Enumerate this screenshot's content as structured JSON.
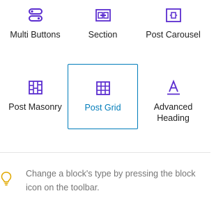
{
  "blocks": [
    {
      "label": "Multi Buttons",
      "icon": "toggle-buttons-icon"
    },
    {
      "label": "Section",
      "icon": "section-icon"
    },
    {
      "label": "Post Carousel",
      "icon": "carousel-icon"
    },
    {
      "label": "Post Masonry",
      "icon": "masonry-icon"
    },
    {
      "label": "Post Grid",
      "icon": "grid-icon",
      "selected": true
    },
    {
      "label": "Advanced Heading",
      "icon": "heading-icon"
    }
  ],
  "tip": {
    "icon": "lightbulb-icon",
    "text": "Change a block's type by pressing the block icon on the toolbar."
  },
  "colors": {
    "icon": "#5b2dcf",
    "selected": "#007cba",
    "tip_icon": "#e0a800",
    "tip_text": "#757575"
  }
}
